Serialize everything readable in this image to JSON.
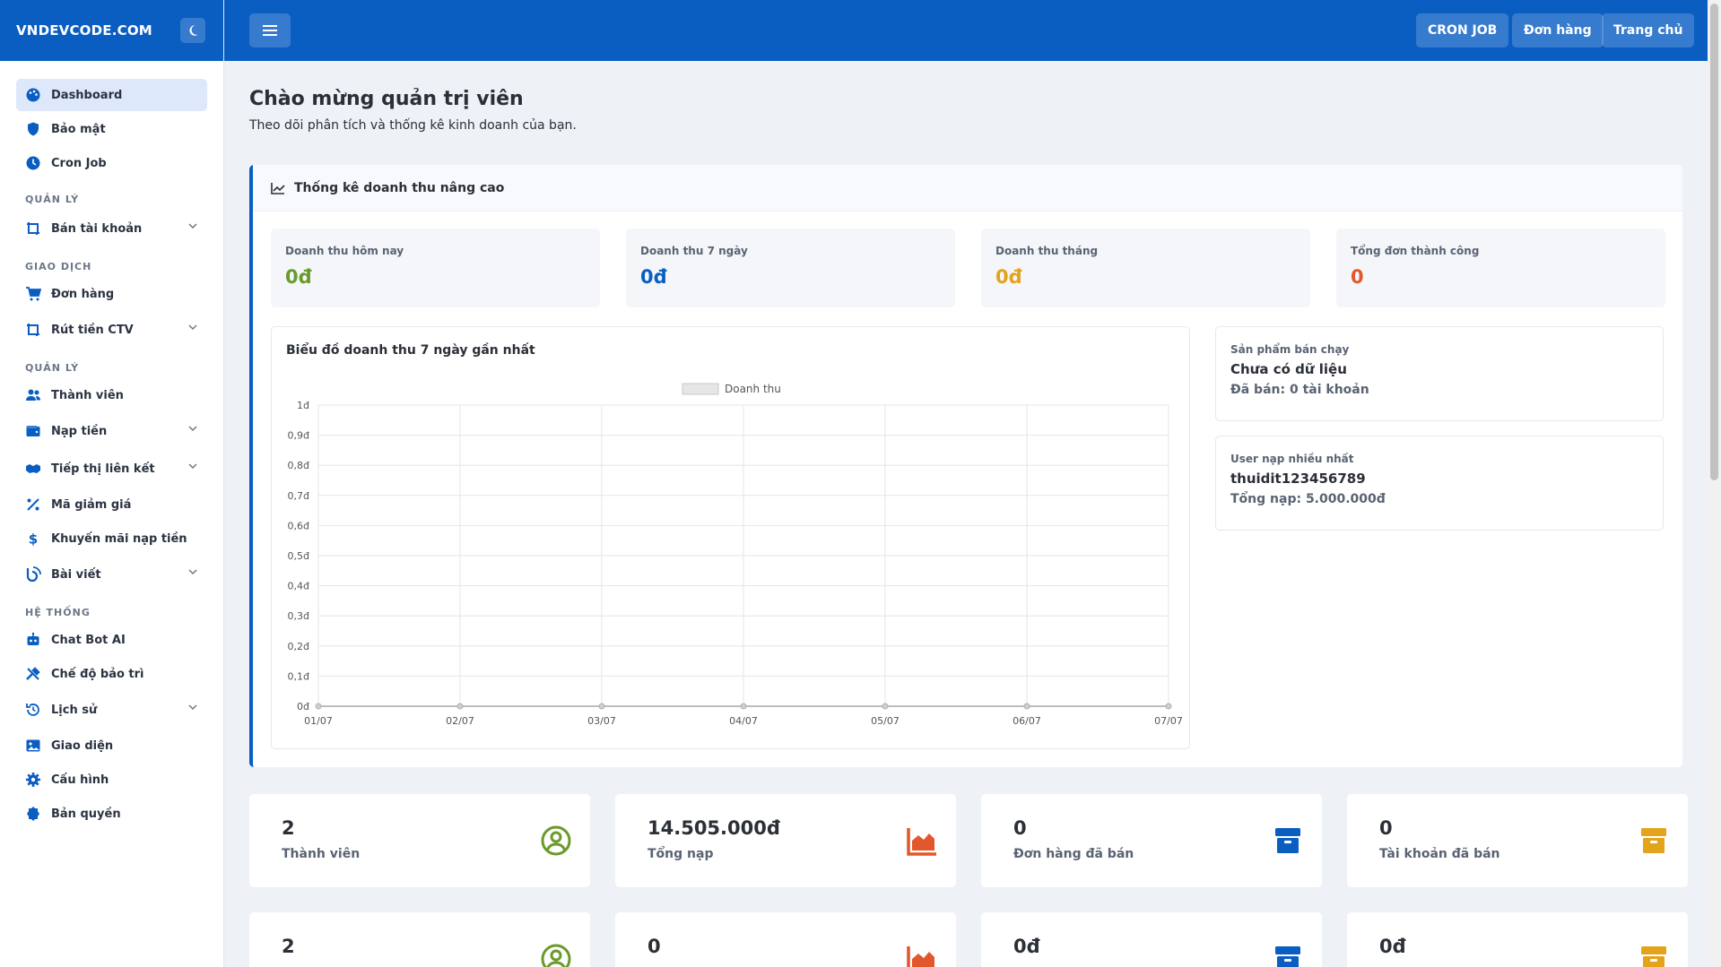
{
  "brand": "VNDEVCODE.COM",
  "topbar": {
    "buttons": [
      "CRON JOB",
      "Đơn hàng",
      "Trang chủ"
    ]
  },
  "sidebar": {
    "top_items": [
      {
        "label": "Dashboard",
        "icon": "palette-icon"
      },
      {
        "label": "Bảo mật",
        "icon": "shield-icon"
      },
      {
        "label": "Cron Job",
        "icon": "clock-icon"
      }
    ],
    "sections": [
      {
        "title": "QUẢN LÝ",
        "items": [
          {
            "label": "Bán tài khoản",
            "icon": "crop-icon",
            "has_children": true
          }
        ]
      },
      {
        "title": "GIAO DỊCH",
        "items": [
          {
            "label": "Đơn hàng",
            "icon": "cart-icon",
            "has_children": false
          },
          {
            "label": "Rút tiền CTV",
            "icon": "crop-icon",
            "has_children": true
          }
        ]
      },
      {
        "title": "QUẢN LÝ",
        "items": [
          {
            "label": "Thành viên",
            "icon": "users-icon",
            "has_children": false
          },
          {
            "label": "Nạp tiền",
            "icon": "wallet-icon",
            "has_children": true
          },
          {
            "label": "Tiếp thị liên kết",
            "icon": "handshake-icon",
            "has_children": true
          },
          {
            "label": "Mã giảm giá",
            "icon": "percent-icon",
            "has_children": false
          },
          {
            "label": "Khuyến mãi nạp tiền",
            "icon": "dollar-icon",
            "has_children": false
          },
          {
            "label": "Bài viết",
            "icon": "blog-icon",
            "has_children": true
          }
        ]
      },
      {
        "title": "HỆ THỐNG",
        "items": [
          {
            "label": "Chat Bot AI",
            "icon": "robot-icon",
            "has_children": false
          },
          {
            "label": "Chế độ bảo trì",
            "icon": "tools-icon",
            "has_children": false
          },
          {
            "label": "Lịch sử",
            "icon": "history-icon",
            "has_children": true
          },
          {
            "label": "Giao diện",
            "icon": "image-icon",
            "has_children": false
          },
          {
            "label": "Cấu hình",
            "icon": "gear-icon",
            "has_children": false
          },
          {
            "label": "Bản quyền",
            "icon": "certificate-icon",
            "has_children": false
          }
        ]
      }
    ]
  },
  "header": {
    "title": "Chào mừng quản trị viên",
    "subtitle": "Theo dõi phân tích và thống kê kinh doanh của bạn."
  },
  "revenue_card": {
    "title": "Thống kê doanh thu nâng cao",
    "stats": [
      {
        "label": "Doanh thu hôm nay",
        "value": "0đ",
        "color": "#6a9a2a"
      },
      {
        "label": "Doanh thu 7 ngày",
        "value": "0đ",
        "color": "#0a5ec2"
      },
      {
        "label": "Doanh thu tháng",
        "value": "0đ",
        "color": "#e3a31b"
      },
      {
        "label": "Tổng đơn thành công",
        "value": "0",
        "color": "#e2572b"
      }
    ],
    "chart_title": "Biểu đồ doanh thu 7 ngày gần nhất",
    "best_product": {
      "label": "Sản phẩm bán chạy",
      "value": "Chưa có dữ liệu",
      "sub": "Đã bán: 0 tài khoản"
    },
    "top_user": {
      "label": "User nạp nhiều nhất",
      "value": "thuidit123456789",
      "sub": "Tổng nạp: 5.000.000đ"
    }
  },
  "chart_data": {
    "type": "line",
    "title": "",
    "x": [
      "01/07",
      "02/07",
      "03/07",
      "04/07",
      "05/07",
      "06/07",
      "07/07"
    ],
    "series": [
      {
        "name": "Doanh thu",
        "values": [
          0,
          0,
          0,
          0,
          0,
          0,
          0
        ]
      }
    ],
    "yticks": [
      "0đ",
      "0,1đ",
      "0,2đ",
      "0,3đ",
      "0,4đ",
      "0,5đ",
      "0,6đ",
      "0,7đ",
      "0,8đ",
      "0,9đ",
      "1đ"
    ],
    "ylim": [
      0,
      1
    ],
    "grid": true,
    "legend": "top-center"
  },
  "kpis_row1": [
    {
      "value": "2",
      "caption": "Thành viên",
      "icon": "user-circle-icon",
      "color": "#6a9a2a"
    },
    {
      "value": "14.505.000đ",
      "caption": "Tổng nạp",
      "icon": "area-chart-icon",
      "color": "#e2572b"
    },
    {
      "value": "0",
      "caption": "Đơn hàng đã bán",
      "icon": "box-icon",
      "color": "#0a5ec2"
    },
    {
      "value": "0",
      "caption": "Tài khoản đã bán",
      "icon": "box-icon",
      "color": "#e3a31b"
    }
  ],
  "kpis_row2": [
    {
      "value": "2",
      "icon": "user-circle-icon",
      "color": "#6a9a2a"
    },
    {
      "value": "0",
      "icon": "area-chart-icon",
      "color": "#e2572b"
    },
    {
      "value": "0đ",
      "icon": "box-icon",
      "color": "#0a5ec2"
    },
    {
      "value": "0đ",
      "icon": "box-icon",
      "color": "#e3a31b"
    }
  ]
}
